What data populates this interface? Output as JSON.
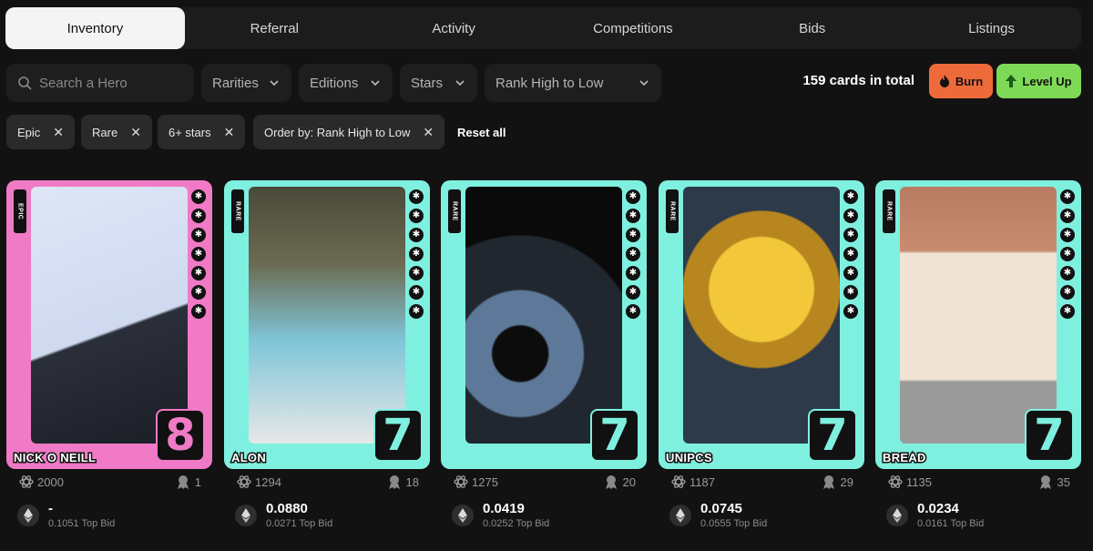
{
  "tabs": [
    {
      "label": "Inventory",
      "active": true
    },
    {
      "label": "Referral"
    },
    {
      "label": "Activity"
    },
    {
      "label": "Competitions"
    },
    {
      "label": "Bids"
    },
    {
      "label": "Listings"
    }
  ],
  "search": {
    "placeholder": "Search a Hero"
  },
  "filters": {
    "rarities": "Rarities",
    "editions": "Editions",
    "stars": "Stars",
    "order": "Rank High to Low"
  },
  "total_label": "159 cards in total",
  "actions": {
    "burn": "Burn",
    "level_up": "Level Up"
  },
  "chips": [
    "Epic",
    "Rare",
    "6+ stars",
    "Order by: Rank High to Low"
  ],
  "reset_label": "Reset all",
  "colors": {
    "epic": "#f07ac6",
    "rare": "#7ff0e0",
    "burn": "#ef6a3a",
    "level_up": "#7ed957"
  },
  "cards": [
    {
      "rarity": "EPIC",
      "name": "NICK O NEILL",
      "level": "8",
      "score": "2000",
      "rank": "1",
      "price": "-",
      "top_bid": "0.1051",
      "top_bid_label": "Top Bid"
    },
    {
      "rarity": "RARE",
      "name": "ALON",
      "level": "7",
      "score": "1294",
      "rank": "18",
      "price": "0.0880",
      "top_bid": "0.0271",
      "top_bid_label": "Top Bid"
    },
    {
      "rarity": "RARE",
      "name": "",
      "level": "7",
      "score": "1275",
      "rank": "20",
      "price": "0.0419",
      "top_bid": "0.0252",
      "top_bid_label": "Top Bid"
    },
    {
      "rarity": "RARE",
      "name": "UNIPCS",
      "level": "7",
      "score": "1187",
      "rank": "29",
      "price": "0.0745",
      "top_bid": "0.0555",
      "top_bid_label": "Top Bid"
    },
    {
      "rarity": "RARE",
      "name": "BREAD",
      "level": "7",
      "score": "1135",
      "rank": "35",
      "price": "0.0234",
      "top_bid": "0.0161",
      "top_bid_label": "Top Bid"
    }
  ]
}
